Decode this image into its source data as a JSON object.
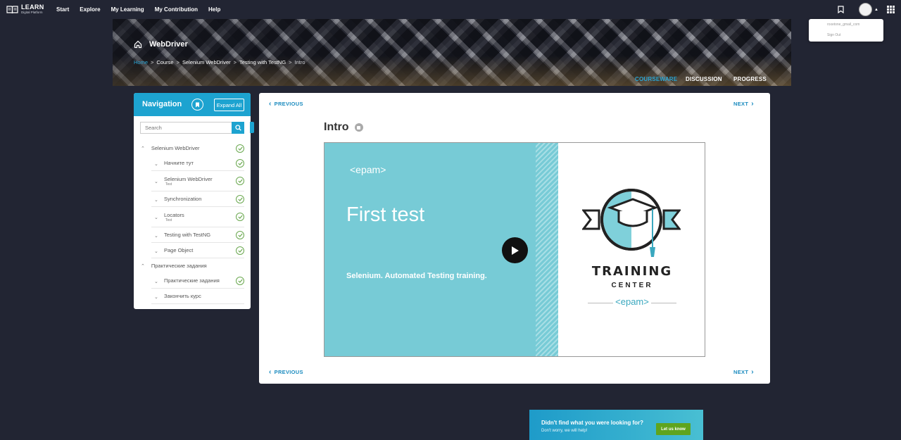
{
  "topbar": {
    "logo_title": "LEARN",
    "logo_sub": "Digital Platform",
    "nav": [
      "Start",
      "Explore",
      "My Learning",
      "My Contribution",
      "Help"
    ]
  },
  "user_menu": {
    "email": "roxetone_gmail_com",
    "sign_out": "Sign Out"
  },
  "banner": {
    "title": "WebDriver",
    "breadcrumbs": [
      "Home",
      "Course",
      "Selenium WebDriver",
      "Testing with TestNG",
      "Intro"
    ],
    "tabs": [
      "COURSEWARE",
      "DISCUSSION",
      "PROGRESS"
    ],
    "active_tab": "COURSEWARE"
  },
  "navigation": {
    "title": "Navigation",
    "expand_label": "Expand All",
    "search_placeholder": "Search",
    "sections": [
      {
        "label": "Selenium WebDriver",
        "completed": true,
        "items": [
          {
            "label": "Начните тут",
            "sub": "",
            "completed": true
          },
          {
            "label": "Selenium WebDriver",
            "sub": "Test",
            "completed": true
          },
          {
            "label": "Synchronization",
            "sub": "",
            "completed": true
          },
          {
            "label": "Locators",
            "sub": "Test",
            "completed": true
          },
          {
            "label": "Testing with TestNG",
            "sub": "",
            "completed": true
          },
          {
            "label": "Page Object",
            "sub": "",
            "completed": true
          }
        ]
      },
      {
        "label": "Практические задания",
        "completed": false,
        "items": [
          {
            "label": "Практические задания",
            "sub": "",
            "completed": true
          },
          {
            "label": "Закончить курс",
            "sub": "",
            "completed": false
          }
        ]
      }
    ]
  },
  "content": {
    "previous_label": "PREVIOUS",
    "next_label": "NEXT",
    "unit_title": "Intro",
    "video": {
      "brand": "<epam>",
      "title": "First test",
      "subtitle": "Selenium. Automated Testing training.",
      "tc_line1": "TRAINING",
      "tc_line2": "CENTER",
      "tc_brand": "<epam>"
    }
  },
  "feedback": {
    "title": "Didn't find what you were looking for?",
    "subtitle": "Don't worry, we will help!",
    "button": "Let us know"
  },
  "colors": {
    "accent": "#1da3d0",
    "check_green": "#6aa84f",
    "video_teal": "#77cbd6",
    "feedback_button": "#5fa41e"
  }
}
